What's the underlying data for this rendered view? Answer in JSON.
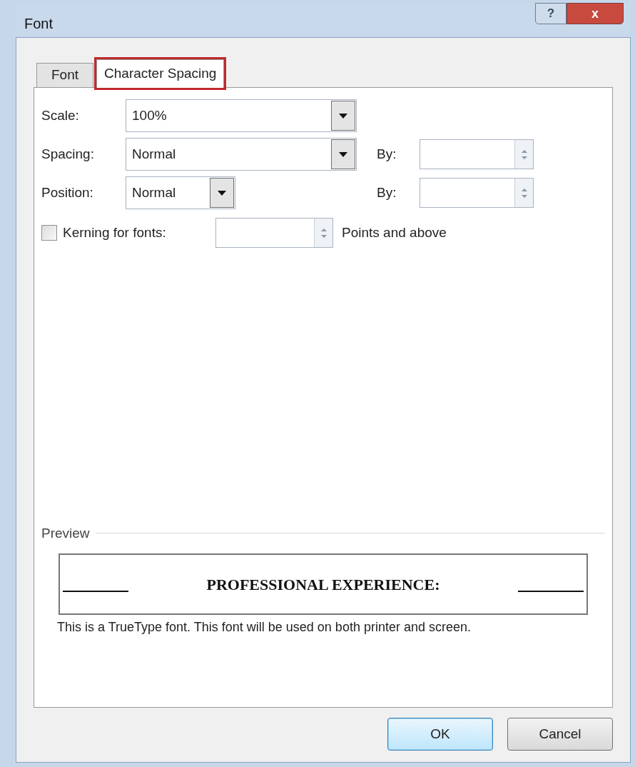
{
  "window": {
    "title": "Font",
    "help_button": "?",
    "close_button": "x"
  },
  "tabs": [
    {
      "label": "Font",
      "selected": false,
      "highlighted": false
    },
    {
      "label": "Character Spacing",
      "selected": true,
      "highlighted": true
    }
  ],
  "fields": [
    {
      "label": "Scale:",
      "kind": "dropdown",
      "value": "100%"
    },
    {
      "label": "Spacing:",
      "kind": "dropdown",
      "value": "Normal",
      "by_label": "By:"
    },
    {
      "label": "Position:",
      "kind": "short_dropdown",
      "value": "Normal",
      "by_label": "By:"
    }
  ],
  "kerning": {
    "label": "Kerning for fonts:",
    "checked": false,
    "suffix": "Points and above"
  },
  "preview": {
    "label": "Preview",
    "sample": "PROFESSIONAL EXPERIENCE:",
    "note": "This is a TrueType font. This font will be used on both printer and screen."
  },
  "buttons": [
    {
      "label": "OK",
      "default": true
    },
    {
      "label": "Cancel",
      "default": false
    }
  ]
}
